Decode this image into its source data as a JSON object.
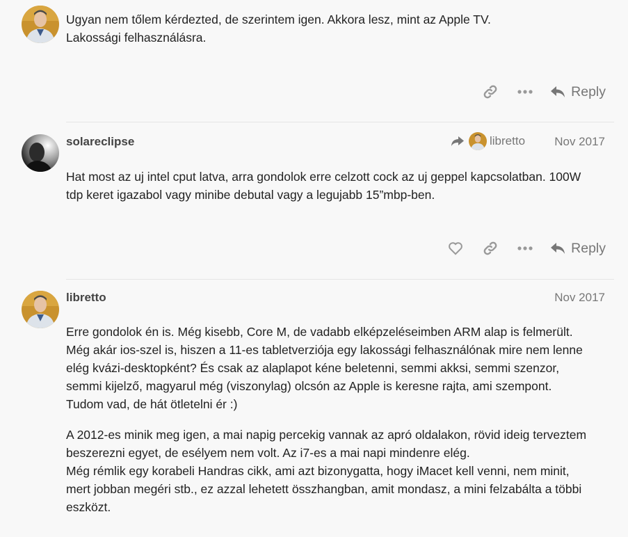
{
  "post1": {
    "lines": [
      "Ugyan nem tőlem kérdezted, de szerintem igen. Akkora lesz, mint az Apple TV.",
      "Lakossági felhasználásra."
    ],
    "actions": {
      "reply_label": "Reply"
    }
  },
  "post2": {
    "username": "solareclipse",
    "reply_to": "libretto",
    "date": "Nov 2017",
    "lines": [
      "Hat most az uj intel cput latva, arra gondolok erre celzott cock az uj geppel kapcsolatban. 100W",
      "tdp keret igazabol vagy minibe debutal vagy a legujabb 15”mbp-ben."
    ],
    "actions": {
      "reply_label": "Reply"
    }
  },
  "post3": {
    "username": "libretto",
    "date": "Nov 2017",
    "para1": [
      "Erre gondolok én is. Még kisebb, Core M, de vadabb elképzeléseimben ARM alap is felmerült.",
      "Még akár ios-szel is, hiszen a 11-es tabletverziója egy lakossági felhasználónak mire nem lenne",
      "elég kvázi-desktopként? És csak az alaplapot kéne beletenni, semmi akksi, semmi szenzor,",
      "semmi kijelző, magyarul még (viszonylag) olcsón az Apple is keresne rajta, ami szempont.",
      "Tudom vad, de hát ötletelni ér :)"
    ],
    "para2": [
      "A 2012-es minik meg igen, a mai napig percekig vannak az apró oldalakon, rövid ideig terveztem",
      "beszerezni egyet, de esélyem nem volt. Az i7-es a mai napi mindenre elég.",
      "Még rémlik egy korabeli Handras cikk, ami azt bizonygatta, hogy iMacet kell venni, nem minit,",
      "mert jobban megéri stb., ez azzal lehetett összhangban, amit mondasz, a mini felzabálta a többi",
      "eszközt."
    ]
  },
  "colors": {
    "muted": "#777777",
    "icon": "#999999",
    "divider": "#e5e5e5",
    "background": "#f8f8f8"
  }
}
